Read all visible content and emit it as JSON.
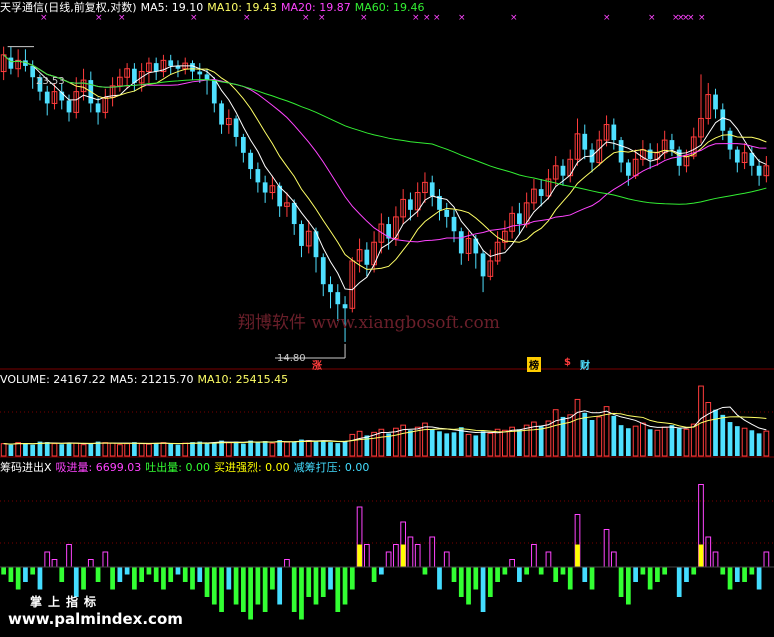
{
  "colors": {
    "up": "#ff3c3c",
    "down": "#4fe0ff",
    "ma5": "#ffffff",
    "ma10": "#ffff66",
    "ma20": "#ff44ff",
    "ma60": "#33ee33",
    "absorb": "#ff44ff",
    "spit": "#33ff33",
    "buy": "#ffff00",
    "reduce": "#44ddff",
    "grid": "#7a0000"
  },
  "header": {
    "title": "天孚通信(日线,前复权,对数)",
    "ma5": "MA5: 19.10",
    "ma10": "MA10: 19.43",
    "ma20": "MA20: 19.87",
    "ma60": "MA60: 19.46"
  },
  "volume_header": {
    "title": "VOLUME: 24167.22",
    "ma5": "MA5: 21215.70",
    "ma10": "MA10: 25415.45"
  },
  "chip_header": {
    "title": "筹码进出X",
    "absorb": "吸进量: 6699.03",
    "spit": "吐出量: 0.00",
    "buy": "买进强烈: 0.00",
    "reduce": "减筹打压: 0.00"
  },
  "price_labels": {
    "high": "23.53",
    "low": "14.80"
  },
  "markers": {
    "zhang": "涨",
    "bang": "榜",
    "dollar": "$",
    "cai": "财"
  },
  "watermark": "翔博软件 www.xiangbosoft.com",
  "brand": {
    "line1": "掌上指标",
    "line2": "www.palmindex.com"
  },
  "chart_data": [
    {
      "type": "candlestick",
      "title": "天孚通信(日线,前复权,对数)",
      "ylim": [
        14.5,
        24.5
      ],
      "candles": [
        [
          22.6,
          23.2,
          22.3,
          23.5
        ],
        [
          23.1,
          22.7,
          22.5,
          23.5
        ],
        [
          22.7,
          23.0,
          22.4,
          23.4
        ],
        [
          23.0,
          22.8,
          22.6,
          23.4
        ],
        [
          22.8,
          22.4,
          22.0,
          23.0
        ],
        [
          22.4,
          21.9,
          21.6,
          22.5
        ],
        [
          21.9,
          21.5,
          21.1,
          22.1
        ],
        [
          21.5,
          21.9,
          21.3,
          22.2
        ],
        [
          21.9,
          21.6,
          21.3,
          22.2
        ],
        [
          21.6,
          21.2,
          20.9,
          21.8
        ],
        [
          21.2,
          21.9,
          21.0,
          22.4
        ],
        [
          21.9,
          22.3,
          21.6,
          22.7
        ],
        [
          22.3,
          21.5,
          21.2,
          22.6
        ],
        [
          21.5,
          21.2,
          20.8,
          21.7
        ],
        [
          21.2,
          21.7,
          21.0,
          22.0
        ],
        [
          21.7,
          22.1,
          21.4,
          22.4
        ],
        [
          22.1,
          22.4,
          21.9,
          22.7
        ],
        [
          22.4,
          22.7,
          22.0,
          22.9
        ],
        [
          22.7,
          22.2,
          21.9,
          22.9
        ],
        [
          22.2,
          22.6,
          21.9,
          22.9
        ],
        [
          22.6,
          22.9,
          22.2,
          23.1
        ],
        [
          22.9,
          22.6,
          22.3,
          23.1
        ],
        [
          22.6,
          23.0,
          22.4,
          23.2
        ],
        [
          23.0,
          22.8,
          22.5,
          23.2
        ],
        [
          22.8,
          22.7,
          22.4,
          23.0
        ],
        [
          22.7,
          22.9,
          22.5,
          23.1
        ],
        [
          22.9,
          22.6,
          22.3,
          23.0
        ],
        [
          22.6,
          22.5,
          22.2,
          22.9
        ],
        [
          22.5,
          22.3,
          21.8,
          22.7
        ],
        [
          22.3,
          21.5,
          21.2,
          22.4
        ],
        [
          21.5,
          20.8,
          20.5,
          21.6
        ],
        [
          20.8,
          21.0,
          20.5,
          21.3
        ],
        [
          21.0,
          20.4,
          20.1,
          21.1
        ],
        [
          20.4,
          19.9,
          19.6,
          20.5
        ],
        [
          19.9,
          19.4,
          19.1,
          20.0
        ],
        [
          19.4,
          19.0,
          18.7,
          19.6
        ],
        [
          19.0,
          18.7,
          18.4,
          19.2
        ],
        [
          18.7,
          18.9,
          18.5,
          19.2
        ],
        [
          18.9,
          18.3,
          18.0,
          19.0
        ],
        [
          18.3,
          18.4,
          18.0,
          18.7
        ],
        [
          18.4,
          17.8,
          17.5,
          18.5
        ],
        [
          17.8,
          17.2,
          16.9,
          17.9
        ],
        [
          17.2,
          17.6,
          17.0,
          17.9
        ],
        [
          17.6,
          16.9,
          16.5,
          17.7
        ],
        [
          16.9,
          16.2,
          15.9,
          17.0
        ],
        [
          16.2,
          16.0,
          15.6,
          16.4
        ],
        [
          16.0,
          15.7,
          15.3,
          16.2
        ],
        [
          15.7,
          15.6,
          14.8,
          15.9
        ],
        [
          15.6,
          16.8,
          15.5,
          16.9
        ],
        [
          16.8,
          17.1,
          16.5,
          17.4
        ],
        [
          17.1,
          16.7,
          16.4,
          17.3
        ],
        [
          16.7,
          17.3,
          16.5,
          17.6
        ],
        [
          17.3,
          17.8,
          17.0,
          18.1
        ],
        [
          17.8,
          17.4,
          17.1,
          18.0
        ],
        [
          17.4,
          18.0,
          17.2,
          18.3
        ],
        [
          18.0,
          18.5,
          17.8,
          18.8
        ],
        [
          18.5,
          18.2,
          17.9,
          18.7
        ],
        [
          18.2,
          18.7,
          18.0,
          19.0
        ],
        [
          18.7,
          19.0,
          18.4,
          19.3
        ],
        [
          19.0,
          18.6,
          18.3,
          19.2
        ],
        [
          18.6,
          18.2,
          17.9,
          18.8
        ],
        [
          18.2,
          18.0,
          17.7,
          18.4
        ],
        [
          18.0,
          17.6,
          17.3,
          18.2
        ],
        [
          17.6,
          17.0,
          16.7,
          17.7
        ],
        [
          17.0,
          17.4,
          16.8,
          17.6
        ],
        [
          17.4,
          17.0,
          16.6,
          17.5
        ],
        [
          17.0,
          16.4,
          16.0,
          17.1
        ],
        [
          16.4,
          16.8,
          16.3,
          17.1
        ],
        [
          16.8,
          17.3,
          16.7,
          17.6
        ],
        [
          17.3,
          17.6,
          17.1,
          17.9
        ],
        [
          17.6,
          18.1,
          17.4,
          18.3
        ],
        [
          18.1,
          17.8,
          17.5,
          18.4
        ],
        [
          17.8,
          18.4,
          17.7,
          18.7
        ],
        [
          18.4,
          18.8,
          18.2,
          19.1
        ],
        [
          18.8,
          18.6,
          18.3,
          19.1
        ],
        [
          18.6,
          19.1,
          18.5,
          19.4
        ],
        [
          19.1,
          19.5,
          18.9,
          19.8
        ],
        [
          19.5,
          19.2,
          18.9,
          19.7
        ],
        [
          19.2,
          19.7,
          19.0,
          20.0
        ],
        [
          19.7,
          20.5,
          19.5,
          21.0
        ],
        [
          20.5,
          20.0,
          19.7,
          20.8
        ],
        [
          20.0,
          19.6,
          19.3,
          20.2
        ],
        [
          19.6,
          20.3,
          19.5,
          20.6
        ],
        [
          20.3,
          20.8,
          20.1,
          21.1
        ],
        [
          20.8,
          20.3,
          20.0,
          21.0
        ],
        [
          20.3,
          19.6,
          19.3,
          20.4
        ],
        [
          19.6,
          19.2,
          18.9,
          19.7
        ],
        [
          19.2,
          19.7,
          19.1,
          20.0
        ],
        [
          19.7,
          20.0,
          19.5,
          20.3
        ],
        [
          20.0,
          19.7,
          19.4,
          20.2
        ],
        [
          19.7,
          19.9,
          19.5,
          20.2
        ],
        [
          19.9,
          20.3,
          19.7,
          20.6
        ],
        [
          20.3,
          20.0,
          19.8,
          20.5
        ],
        [
          20.0,
          19.5,
          19.2,
          20.1
        ],
        [
          19.5,
          19.8,
          19.3,
          20.0
        ],
        [
          19.8,
          20.4,
          19.7,
          20.7
        ],
        [
          20.4,
          21.0,
          20.2,
          22.5
        ],
        [
          21.0,
          21.8,
          20.8,
          22.2
        ],
        [
          21.8,
          21.3,
          21.0,
          22.0
        ],
        [
          21.3,
          20.6,
          20.3,
          21.5
        ],
        [
          20.6,
          20.0,
          19.7,
          20.7
        ],
        [
          20.0,
          19.6,
          19.3,
          20.1
        ],
        [
          19.6,
          19.9,
          19.4,
          20.2
        ],
        [
          19.9,
          19.5,
          19.2,
          20.1
        ],
        [
          19.5,
          19.2,
          18.9,
          19.7
        ],
        [
          19.2,
          19.5,
          19.0,
          19.8
        ]
      ]
    },
    {
      "type": "bar",
      "title": "VOLUME",
      "series": [
        {
          "name": "VOLUME",
          "values": [
            12000,
            11000,
            13000,
            12500,
            11000,
            14000,
            13500,
            12000,
            11500,
            13000,
            12500,
            11000,
            12000,
            14000,
            13000,
            12500,
            11000,
            12000,
            13500,
            12000,
            11500,
            12500,
            13000,
            12000,
            11000,
            12500,
            13500,
            14000,
            12500,
            13000,
            15000,
            13000,
            14000,
            12000,
            15000,
            13500,
            14500,
            12500,
            15500,
            13500,
            14000,
            16000,
            15000,
            14500,
            15000,
            13500,
            12500,
            14000,
            21000,
            24000,
            20000,
            23000,
            26000,
            22000,
            27000,
            30000,
            25000,
            28000,
            32000,
            26000,
            24000,
            22000,
            23000,
            28000,
            21000,
            20000,
            24000,
            22000,
            26000,
            25000,
            28000,
            26000,
            30000,
            33000,
            29000,
            34000,
            45000,
            38000,
            40000,
            55000,
            42000,
            35000,
            38000,
            48000,
            39000,
            30000,
            27000,
            29000,
            32000,
            26000,
            25000,
            28000,
            30000,
            27000,
            26000,
            31000,
            68000,
            52000,
            45000,
            40000,
            33000,
            29000,
            27000,
            25000,
            22000,
            24167.22
          ]
        }
      ],
      "ma5": 21215.7,
      "ma10": 25415.45
    },
    {
      "type": "bar",
      "title": "筹码进出X",
      "series": [
        {
          "name": "吸进量",
          "values": [
            0,
            0,
            0,
            0,
            0,
            0,
            2,
            1,
            0,
            3,
            0,
            0,
            1,
            0,
            2,
            0,
            0,
            0,
            0,
            0,
            0,
            0,
            0,
            0,
            0,
            0,
            0,
            0,
            0,
            0,
            0,
            0,
            0,
            0,
            0,
            0,
            0,
            0,
            0,
            1,
            0,
            0,
            0,
            0,
            0,
            0,
            0,
            0,
            0,
            8,
            3,
            0,
            0,
            2,
            3,
            6,
            4,
            3,
            0,
            4,
            0,
            2,
            0,
            0,
            0,
            0,
            0,
            0,
            0,
            0,
            1,
            0,
            0,
            3,
            0,
            2,
            0,
            0,
            0,
            7,
            0,
            0,
            0,
            5,
            2,
            0,
            0,
            0,
            0,
            0,
            0,
            0,
            0,
            0,
            0,
            0,
            11,
            4,
            2,
            0,
            0,
            0,
            0,
            0,
            0,
            2
          ]
        },
        {
          "name": "吐出量",
          "values": [
            -1,
            -2,
            -3,
            -2,
            -1,
            -3,
            0,
            0,
            -2,
            0,
            -4,
            -3,
            0,
            -2,
            0,
            -3,
            -2,
            -1,
            -3,
            -2,
            -1,
            -2,
            -3,
            -2,
            -1,
            -2,
            -3,
            -2,
            -4,
            -5,
            -6,
            -3,
            -5,
            -6,
            -7,
            -5,
            -6,
            -3,
            -5,
            0,
            -6,
            -7,
            -4,
            -5,
            -4,
            -3,
            -6,
            -5,
            -3,
            0,
            0,
            -2,
            -1,
            0,
            0,
            0,
            0,
            0,
            -1,
            0,
            -3,
            0,
            -2,
            -4,
            -5,
            -3,
            -6,
            -4,
            -2,
            -1,
            0,
            -2,
            -1,
            0,
            -1,
            0,
            -2,
            -1,
            -3,
            0,
            -2,
            -3,
            0,
            0,
            0,
            -4,
            -5,
            -2,
            -1,
            -3,
            -2,
            -1,
            0,
            -4,
            -2,
            -1,
            0,
            0,
            0,
            -1,
            -3,
            -2,
            -2,
            -1,
            -3,
            0
          ]
        }
      ]
    }
  ]
}
